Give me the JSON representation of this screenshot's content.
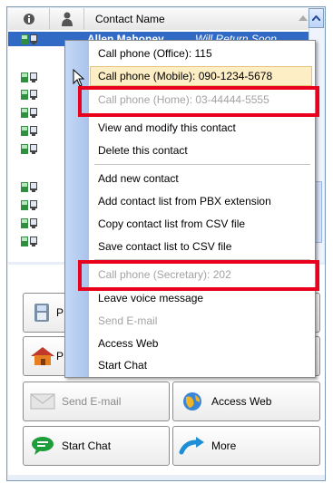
{
  "header": {
    "info_icon": "info-icon",
    "person_icon": "person-icon",
    "column_title": "Contact Name"
  },
  "list": {
    "selected": {
      "name": "Allen Mahoney",
      "status": "Will Return Soon"
    },
    "rows": [
      {
        "icon": "presence-icon"
      },
      {
        "icon": "presence-icon"
      },
      {
        "icon": "presence-icon"
      },
      {
        "icon": "presence-icon"
      },
      {
        "icon": "presence-icon"
      },
      {
        "icon": "presence-icon"
      },
      {
        "icon": "presence-icon"
      },
      {
        "icon": "presence-icon"
      },
      {
        "icon": "presence-icon"
      },
      {
        "icon": "presence-icon"
      },
      {
        "icon": "presence-icon"
      }
    ]
  },
  "context_menu": {
    "items": [
      {
        "label": "Call phone (Office): 115",
        "enabled": true
      },
      {
        "label": "Call phone (Mobile): 090-1234-5678",
        "enabled": true,
        "highlighted": true
      },
      {
        "label": "Call phone (Home): 03-44444-5555",
        "enabled": false
      },
      {
        "label": "View and modify this contact",
        "enabled": true
      },
      {
        "label": "Delete this contact",
        "enabled": true
      },
      {
        "label": "Add new contact",
        "enabled": true
      },
      {
        "label": "Add contact list from PBX extension",
        "enabled": true
      },
      {
        "label": "Copy contact list from CSV file",
        "enabled": true
      },
      {
        "label": "Save contact list to CSV file",
        "enabled": true
      },
      {
        "label": "Call phone (Secretary): 202",
        "enabled": false
      },
      {
        "label": "Leave voice message",
        "enabled": true
      },
      {
        "label": "Send E-mail",
        "enabled": false
      },
      {
        "label": "Access Web",
        "enabled": true
      },
      {
        "label": "Start Chat",
        "enabled": true
      }
    ]
  },
  "buttons": {
    "phone_partial": "P",
    "home_partial": "P",
    "send_email": "Send E-mail",
    "access_web": "Access Web",
    "start_chat": "Start Chat",
    "more": "More"
  },
  "colors": {
    "selection": "#316ac5",
    "menu_hover": "#fdeec5",
    "highlight_box": "#e8001c"
  }
}
